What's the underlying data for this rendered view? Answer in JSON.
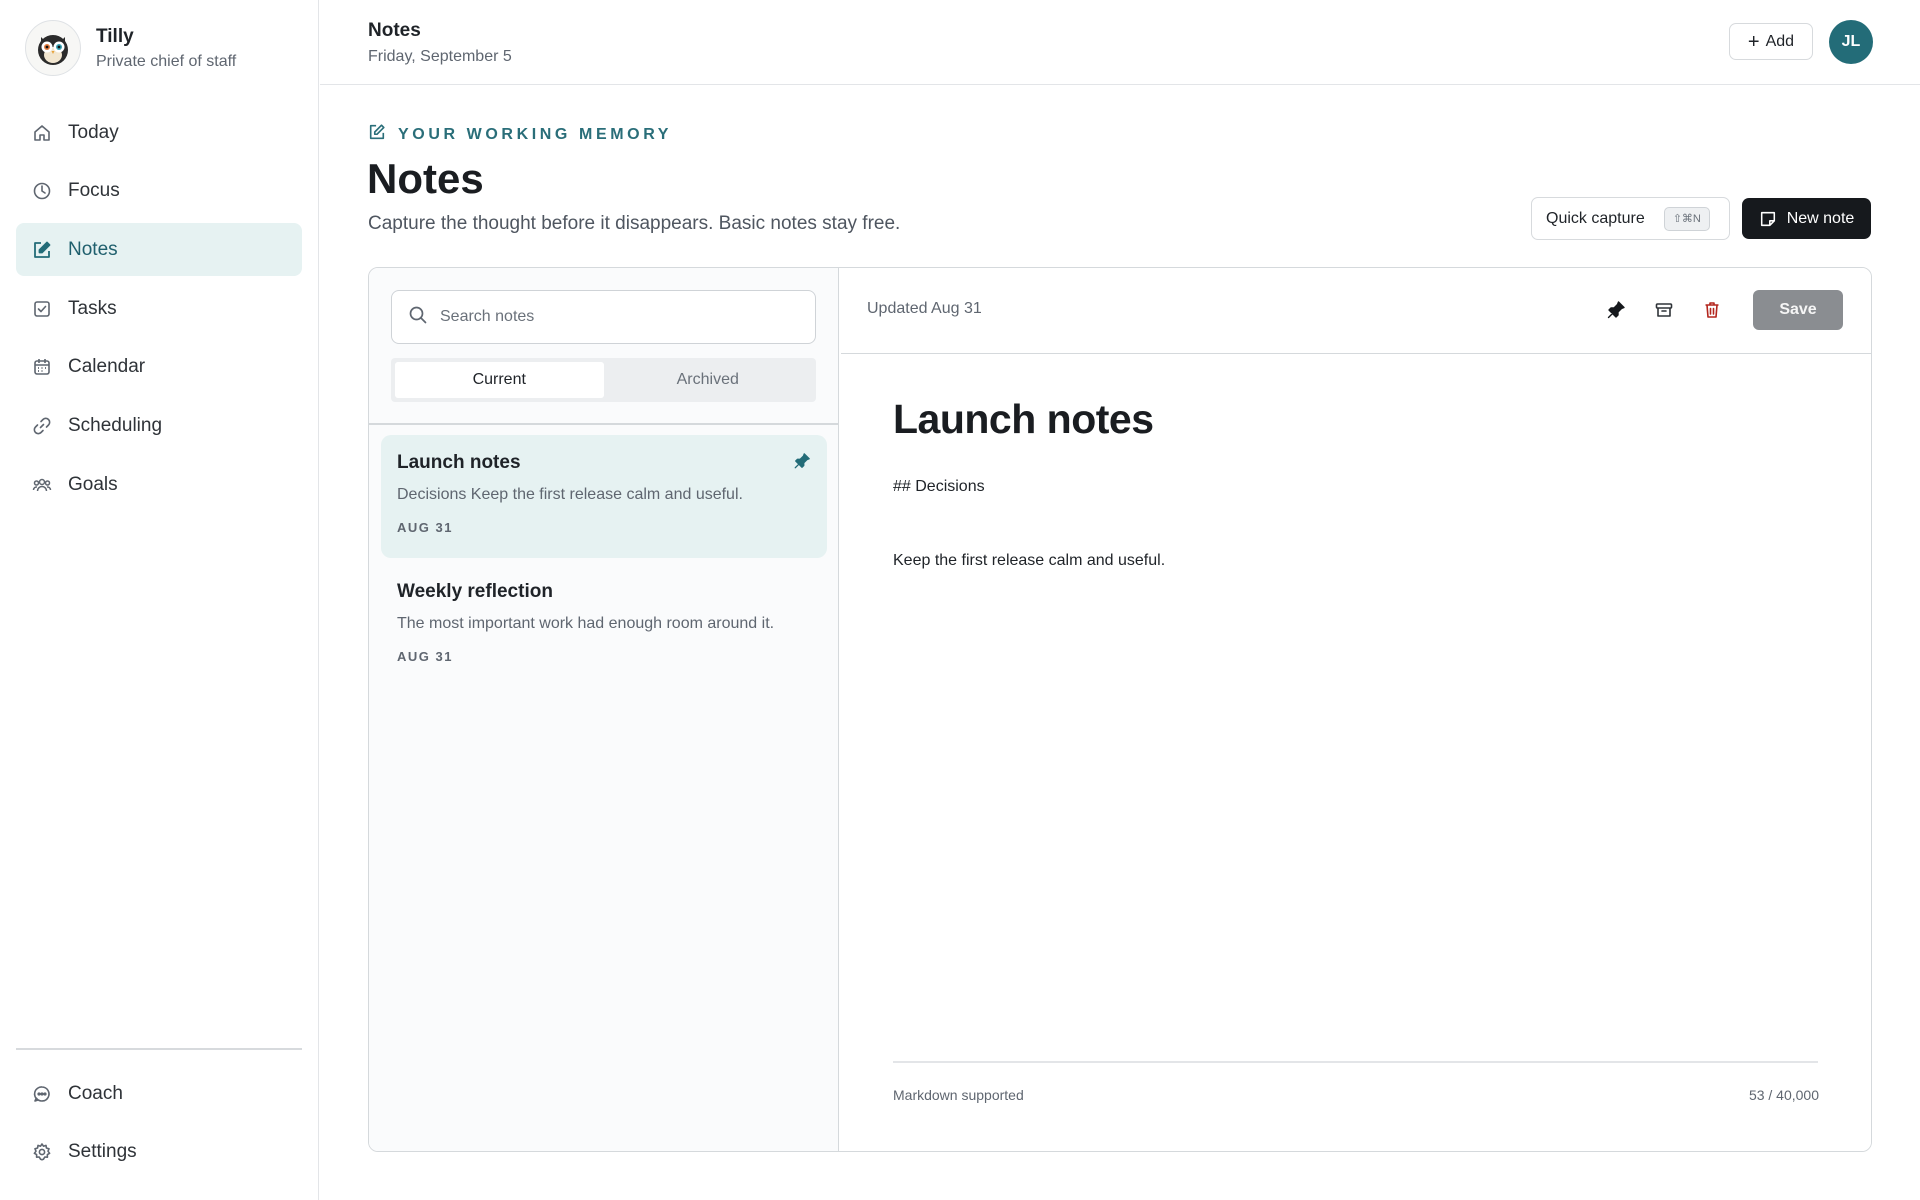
{
  "brand": {
    "name": "Tilly",
    "subtitle": "Private chief of staff"
  },
  "sidebar": {
    "items": [
      {
        "label": "Today",
        "icon": "home-icon",
        "active": false
      },
      {
        "label": "Focus",
        "icon": "focus-icon",
        "active": false
      },
      {
        "label": "Notes",
        "icon": "edit-note-icon",
        "active": true
      },
      {
        "label": "Tasks",
        "icon": "checkbox-icon",
        "active": false
      },
      {
        "label": "Calendar",
        "icon": "calendar-icon",
        "active": false
      },
      {
        "label": "Scheduling",
        "icon": "link-icon",
        "active": false
      },
      {
        "label": "Goals",
        "icon": "people-icon",
        "active": false
      }
    ],
    "bottom_items": [
      {
        "label": "Coach",
        "icon": "chat-icon"
      },
      {
        "label": "Settings",
        "icon": "gear-icon"
      }
    ]
  },
  "header": {
    "title": "Notes",
    "date": "Friday, September 5",
    "add_label": "Add",
    "avatar_initials": "JL"
  },
  "page": {
    "eyebrow": "YOUR WORKING MEMORY",
    "title": "Notes",
    "subtitle": "Capture the thought before it disappears. Basic notes stay free.",
    "quick_capture_label": "Quick capture",
    "quick_capture_shortcut": "⇧⌘N",
    "new_note_label": "New note"
  },
  "notes_list": {
    "search_placeholder": "Search notes",
    "tabs": [
      {
        "label": "Current",
        "active": true
      },
      {
        "label": "Archived",
        "active": false
      }
    ],
    "items": [
      {
        "title": "Launch notes",
        "snippet": "Decisions Keep the first release calm and useful.",
        "date": "AUG 31",
        "pinned": true,
        "active": true
      },
      {
        "title": "Weekly reflection",
        "snippet": "The most important work had enough room around it.",
        "date": "AUG 31",
        "pinned": false,
        "active": false
      }
    ]
  },
  "editor": {
    "updated": "Updated Aug 31",
    "save_label": "Save",
    "title": "Launch notes",
    "body_line1": "## Decisions",
    "body_line2": "Keep the first release calm and useful.",
    "footer_left": "Markdown supported",
    "footer_right": "53 / 40,000"
  },
  "colors": {
    "accent": "#236c78",
    "active_bg": "#e6f2f2",
    "primary_button": "#16191d",
    "save_disabled": "#8a8d91",
    "delete": "#b3261e"
  }
}
